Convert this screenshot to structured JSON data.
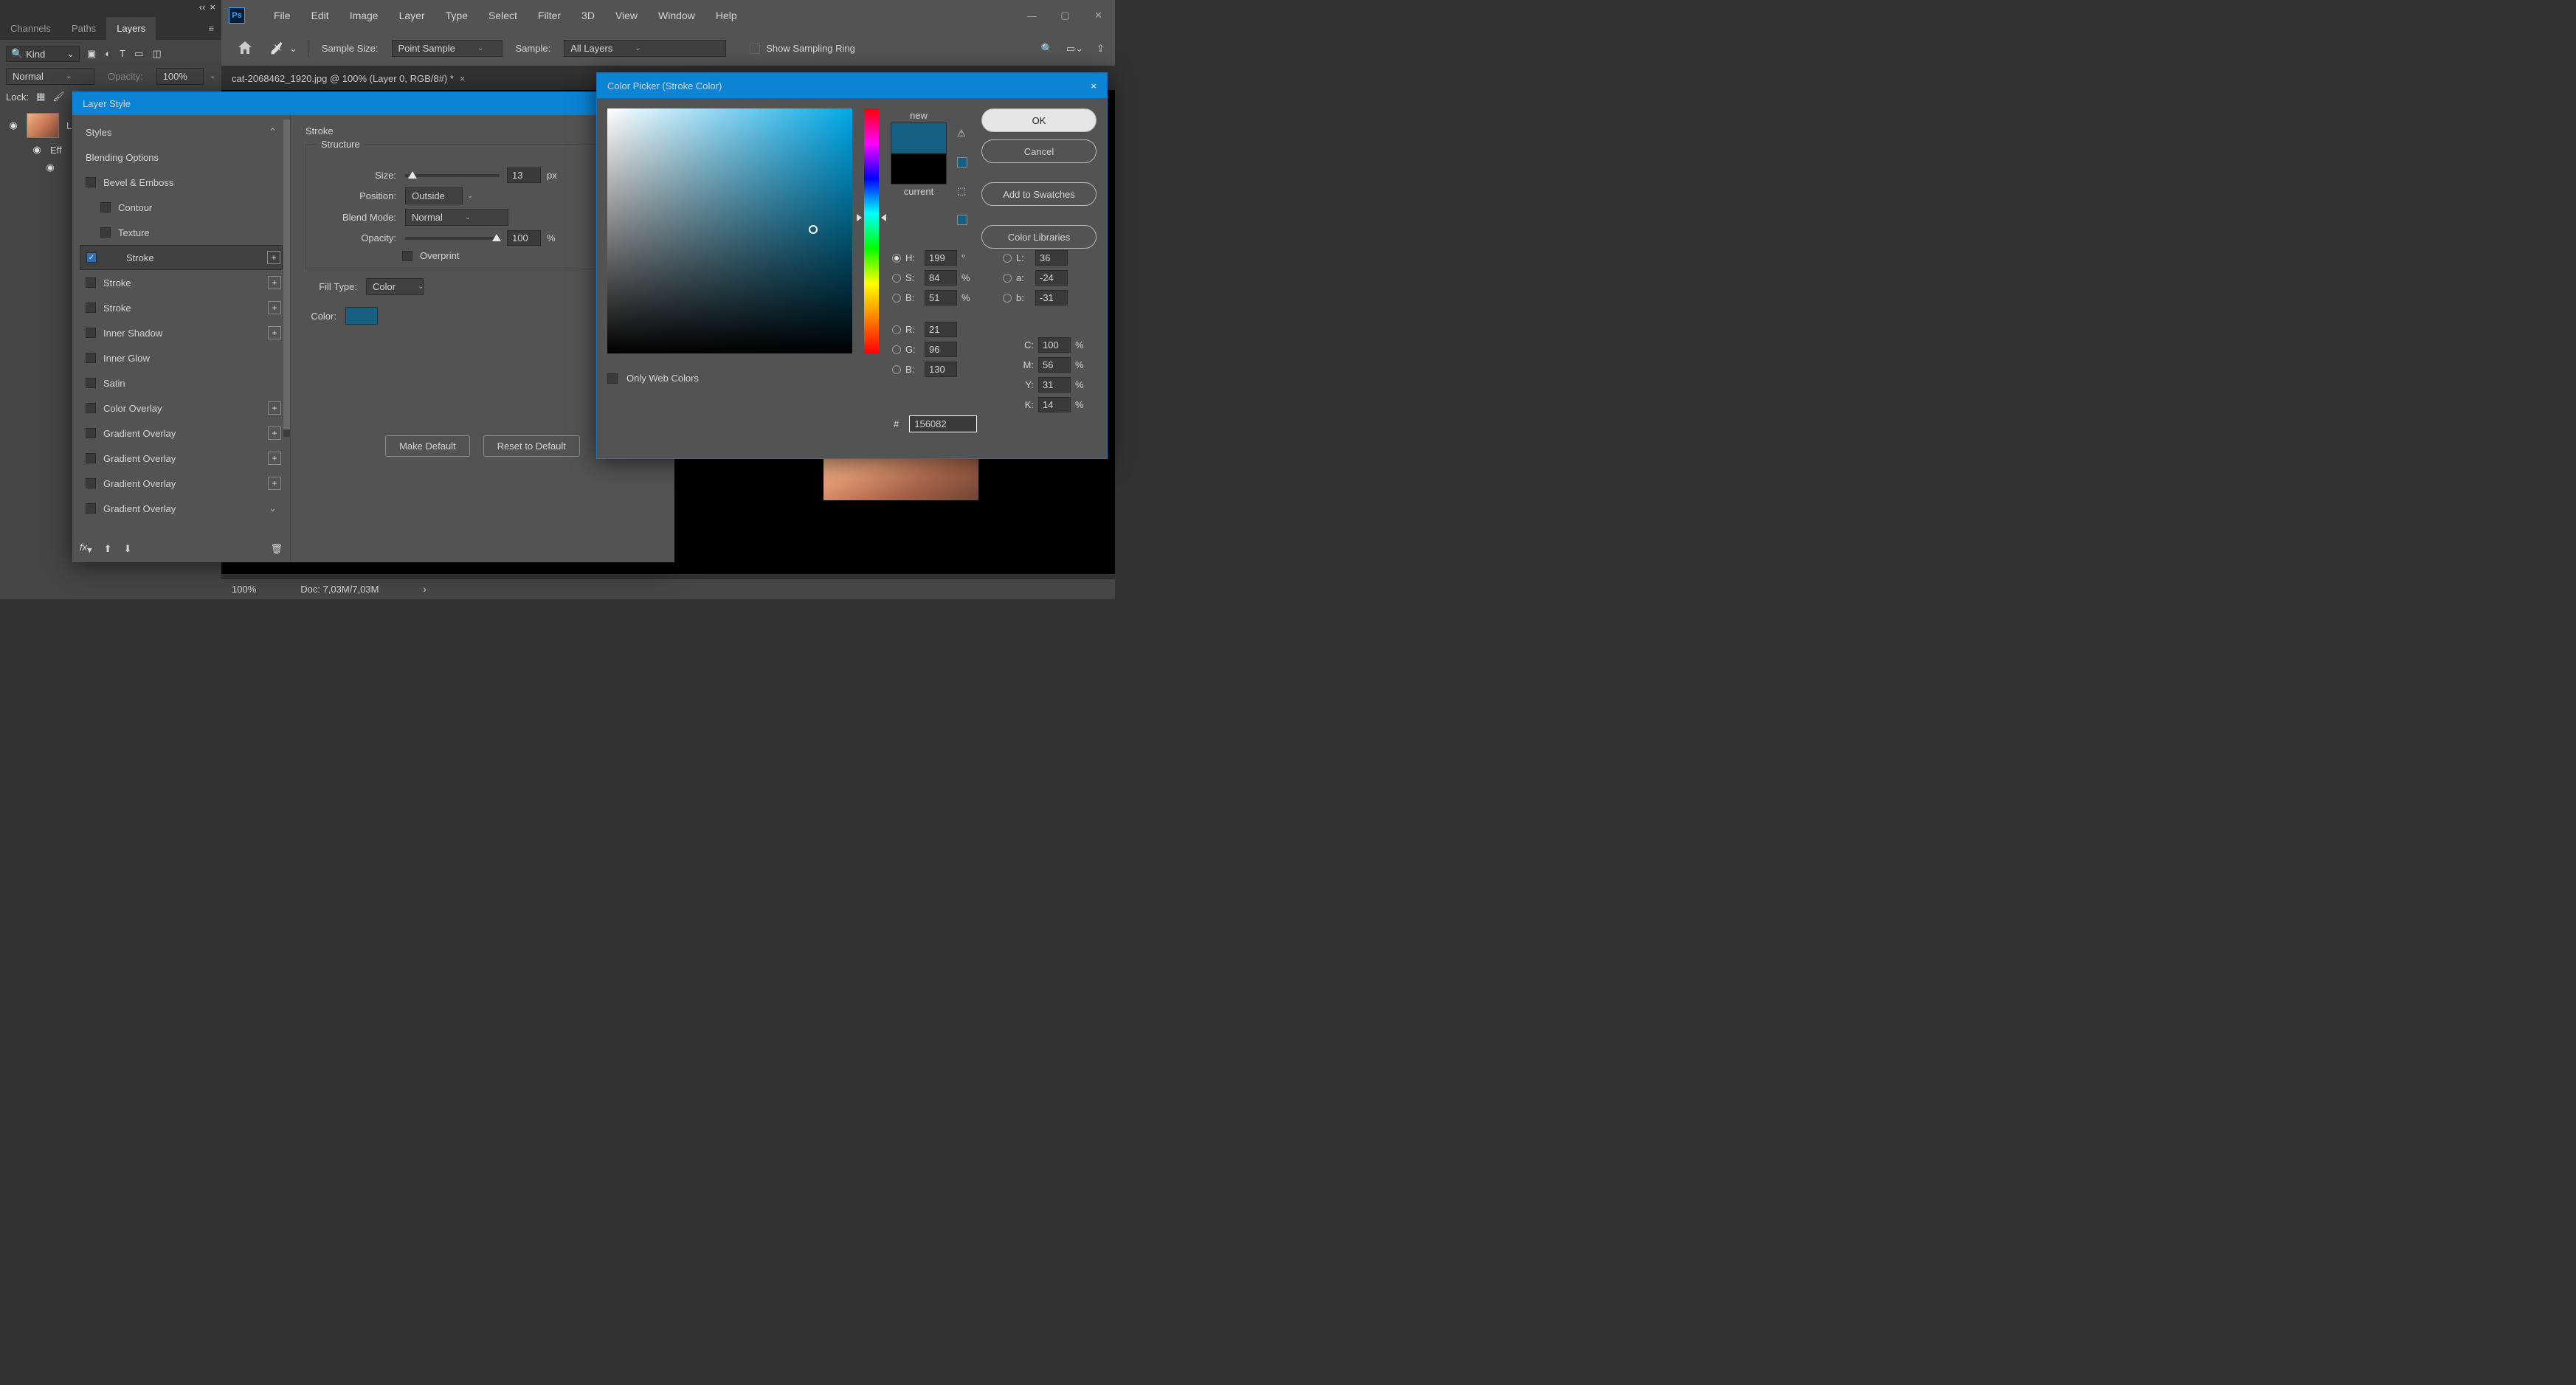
{
  "menu": {
    "items": [
      "File",
      "Edit",
      "Image",
      "Layer",
      "Type",
      "Select",
      "Filter",
      "3D",
      "View",
      "Window",
      "Help"
    ]
  },
  "options_bar": {
    "sample_size_label": "Sample Size:",
    "sample_size_value": "Point Sample",
    "sample_label": "Sample:",
    "sample_value": "All Layers",
    "show_ring": "Show Sampling Ring"
  },
  "document_tab": {
    "title": "cat-2068462_1920.jpg @ 100% (Layer 0, RGB/8#) *"
  },
  "panels": {
    "tabs": [
      "Channels",
      "Paths",
      "Layers"
    ],
    "active_tab": "Layers",
    "kind_label": "Kind",
    "blend_mode": "Normal",
    "opacity_label": "Opacity:",
    "opacity_value": "100%",
    "lock_label": "Lock:",
    "layer0": "L",
    "effects": "Eff",
    "sub_effect": ""
  },
  "layer_style": {
    "title": "Layer Style",
    "list": {
      "styles": "Styles",
      "blending": "Blending Options",
      "bevel": "Bevel & Emboss",
      "contour": "Contour",
      "texture": "Texture",
      "stroke": "Stroke",
      "inner_shadow": "Inner Shadow",
      "inner_glow": "Inner Glow",
      "satin": "Satin",
      "color_overlay": "Color Overlay",
      "gradient_overlay": "Gradient Overlay"
    },
    "section": {
      "heading": "Stroke",
      "structure": "Structure",
      "size": "Size:",
      "size_val": "13",
      "size_unit": "px",
      "position": "Position:",
      "position_val": "Outside",
      "blend_mode": "Blend Mode:",
      "blend_mode_val": "Normal",
      "opacity": "Opacity:",
      "opacity_val": "100",
      "opacity_unit": "%",
      "overprint": "Overprint",
      "fill_type": "Fill Type:",
      "fill_type_val": "Color",
      "color": "Color:",
      "make_default": "Make Default",
      "reset_default": "Reset to Default"
    }
  },
  "color_picker": {
    "title": "Color Picker (Stroke Color)",
    "ok": "OK",
    "cancel": "Cancel",
    "add_swatch": "Add to Swatches",
    "libraries": "Color Libraries",
    "new": "new",
    "current": "current",
    "only_web": "Only Web Colors",
    "new_color": "#156082",
    "current_color": "#000000",
    "hsb": {
      "H": "199",
      "S": "84",
      "B": "51"
    },
    "lab": {
      "L": "36",
      "a": "-24",
      "b": "-31"
    },
    "rgb": {
      "R": "21",
      "G": "96",
      "B": "130"
    },
    "cmyk": {
      "C": "100",
      "M": "56",
      "Y": "31",
      "K": "14"
    },
    "hex": "156082",
    "labels": {
      "H": "H:",
      "S": "S:",
      "B": "B:",
      "L": "L:",
      "a": "a:",
      "b": "b:",
      "R": "R:",
      "G": "G:",
      "Bl": "B:",
      "C": "C:",
      "M": "M:",
      "Y": "Y:",
      "K": "K:",
      "hash": "#",
      "deg": "°",
      "pct": "%"
    }
  },
  "status": {
    "zoom": "100%",
    "doc": "Doc: 7,03M/7,03M"
  }
}
